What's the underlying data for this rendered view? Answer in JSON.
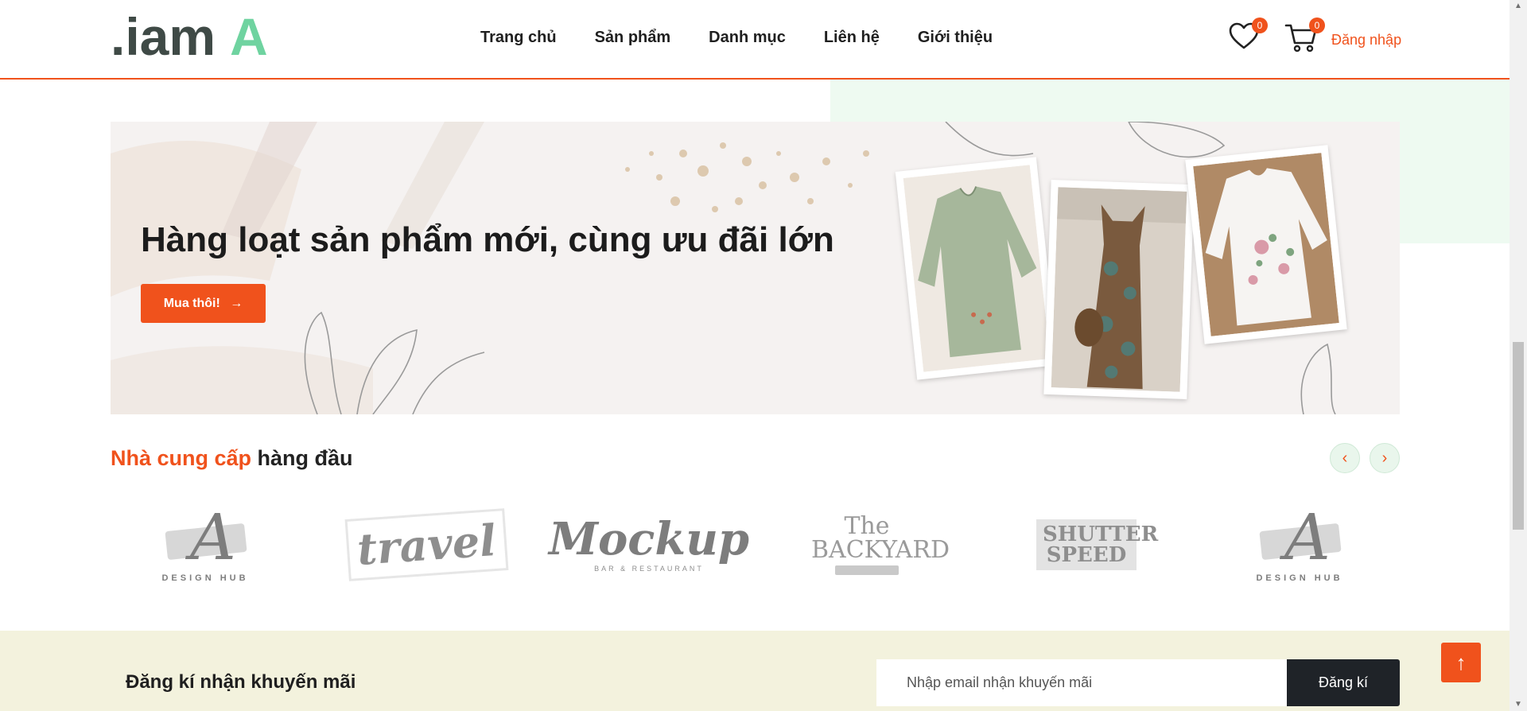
{
  "colors": {
    "accent": "#f0521c",
    "logo_dark": "#3f4a46",
    "logo_green": "#6fd3a0",
    "dark_button": "#1f2328",
    "newsletter_bg": "#f3f2dd"
  },
  "header": {
    "logo_text_dark": ".iam",
    "logo_text_green": "A",
    "nav": [
      "Trang chủ",
      "Sản phẩm",
      "Danh mục",
      "Liên hệ",
      "Giới thiệu"
    ],
    "wishlist": {
      "icon": "heart-icon",
      "count": "0"
    },
    "cart": {
      "icon": "cart-icon",
      "count": "0"
    },
    "login_label": "Đăng nhập"
  },
  "banner": {
    "title": "Hàng loạt sản phẩm mới, cùng ưu đãi lớn",
    "button_label": "Mua thôi!",
    "button_icon": "arrow-right-icon"
  },
  "suppliers": {
    "title_accent": "Nhà cung cấp",
    "title_rest": "hàng đầu",
    "prev_icon": "chevron-left-icon",
    "next_icon": "chevron-right-icon",
    "brands": [
      {
        "main": "A",
        "sub": "DESIGN HUB"
      },
      {
        "main": "travel",
        "sub": ""
      },
      {
        "main": "Mockup",
        "sub": "BAR & RESTAURANT"
      },
      {
        "main": "The BACKYARD",
        "sub": ""
      },
      {
        "main": "SHUTTER SPEED",
        "sub": ""
      },
      {
        "main": "A",
        "sub": "DESIGN HUB"
      }
    ]
  },
  "newsletter": {
    "label": "Đăng kí nhận khuyến mãi",
    "placeholder": "Nhập email nhận khuyến mãi",
    "button_label": "Đăng kí"
  },
  "to_top_icon": "arrow-up-icon"
}
